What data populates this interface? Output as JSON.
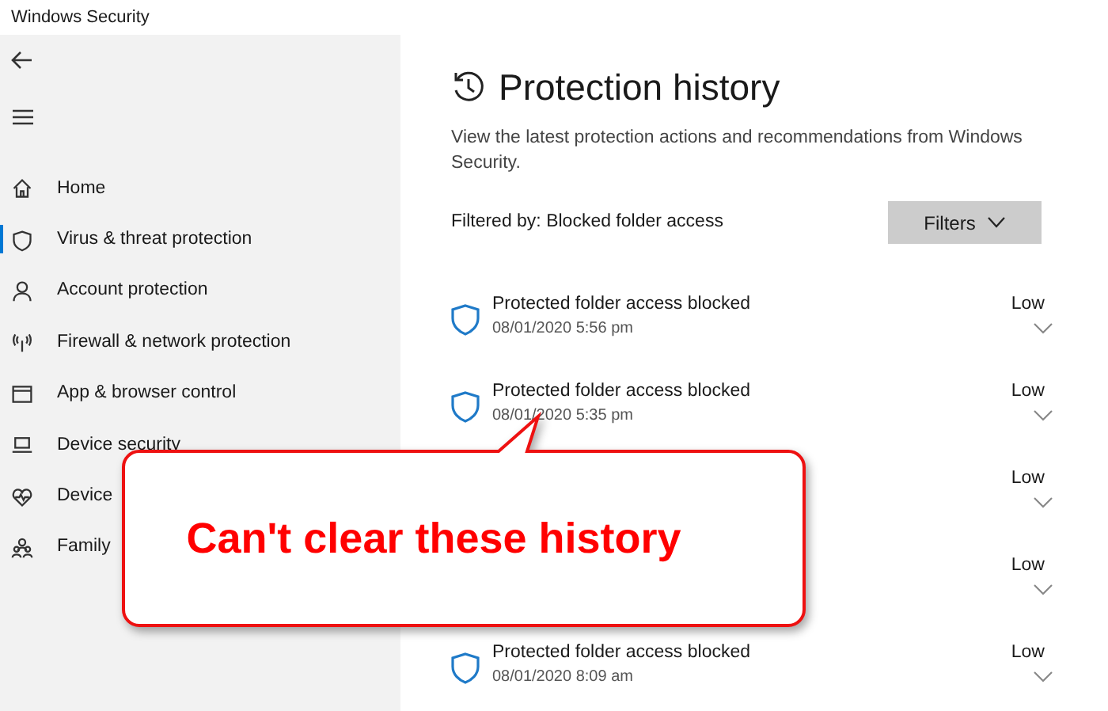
{
  "window": {
    "title": "Windows Security"
  },
  "sidebar": {
    "items": [
      {
        "kind": "home",
        "label": "Home",
        "selected": false
      },
      {
        "kind": "shield",
        "label": "Virus & threat protection",
        "selected": true
      },
      {
        "kind": "person",
        "label": "Account protection",
        "selected": false
      },
      {
        "kind": "antenna",
        "label": "Firewall & network protection",
        "selected": false
      },
      {
        "kind": "window",
        "label": "App & browser control",
        "selected": false
      },
      {
        "kind": "laptop",
        "label": "Device security",
        "selected": false
      },
      {
        "kind": "heart",
        "label": "Device",
        "selected": false
      },
      {
        "kind": "family",
        "label": "Family",
        "selected": false
      }
    ]
  },
  "page": {
    "title": "Protection history",
    "description": "View the latest protection actions and recommendations from Windows Security.",
    "filter": "Filtered by: Blocked folder access",
    "filters_button": "Filters"
  },
  "history": [
    {
      "title": "Protected folder access blocked",
      "date": "08/01/2020 5:56 pm",
      "severity": "Low"
    },
    {
      "title": "Protected folder access blocked",
      "date": "08/01/2020 5:35 pm",
      "severity": "Low"
    },
    {
      "severity": "Low"
    },
    {
      "severity": "Low"
    },
    {
      "title": "Protected folder access blocked",
      "date": "08/01/2020 8:09 am",
      "severity": "Low"
    }
  ],
  "callout": {
    "text": "Can't clear these history"
  }
}
